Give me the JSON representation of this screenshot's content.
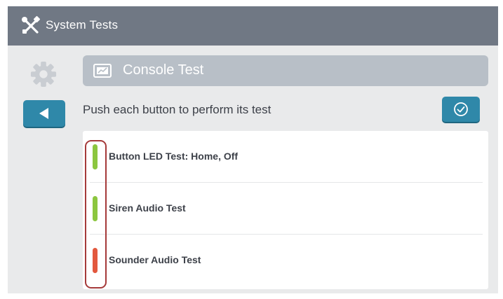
{
  "app": {
    "title": "System Tests",
    "icon": "tools-icon"
  },
  "sidebar": {
    "settings_icon": "gear-icon",
    "back_icon": "back-arrow-icon"
  },
  "header": {
    "title": "Console Test",
    "icon": "console-icon"
  },
  "instruction": "Push each button to perform its test",
  "confirm": {
    "icon": "check-circle-icon"
  },
  "tests": [
    {
      "label": "Button LED Test: Home, Off",
      "status": "pass",
      "color": "#8cc63f"
    },
    {
      "label": "Siren Audio Test",
      "status": "pass",
      "color": "#8cc63f"
    },
    {
      "label": "Sounder Audio Test",
      "status": "fail",
      "color": "#e2583e"
    }
  ],
  "colors": {
    "titlebar": "#707884",
    "accent": "#2f88a9",
    "header_bar": "#b8bfc7",
    "highlight_outline": "#a53a3a"
  }
}
